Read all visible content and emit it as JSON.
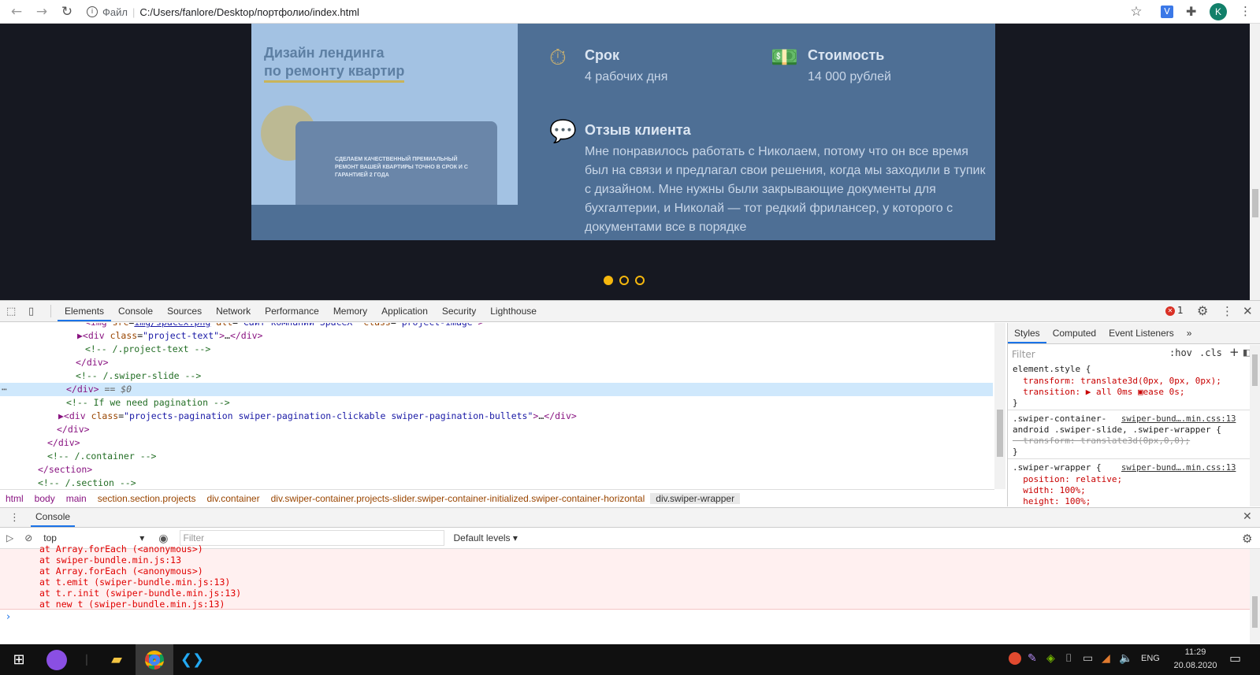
{
  "browser": {
    "protocol_label": "Файл",
    "url": "C:/Users/fanlore/Desktop/портфолио/index.html",
    "profile_initial": "K",
    "ext_label": "V"
  },
  "page": {
    "thumb_title_line1": "Дизайн лендинга",
    "thumb_title_line2": "по ремонту квартир",
    "thumb_screen_text": "СДЕЛАЕМ КАЧЕСТВЕННЫЙ ПРЕМИАЛЬНЫЙ РЕМОНТ ВАШЕЙ КВАРТИРЫ ТОЧНО В СРОК И С ГАРАНТИЕЙ 2 ГОДА",
    "deadline_label": "Срок",
    "deadline_value": "4 рабочих дня",
    "cost_label": "Стоимость",
    "cost_value": "14 000 рублей",
    "review_label": "Отзыв клиента",
    "review_text": "Мне понравилось работать с Николаем, потому что он все время был на связи и предлагал свои решения, когда мы заходили в тупик с дизайном. Мне нужны были закрывающие документы для бухгалтерии, и Николай — тот редкий фрилансер, у которого с документами все в порядке",
    "pagination_active": 1,
    "pagination_count": 3
  },
  "devtools": {
    "tabs": [
      "Elements",
      "Console",
      "Sources",
      "Network",
      "Performance",
      "Memory",
      "Application",
      "Security",
      "Lighthouse"
    ],
    "active_tab": "Elements",
    "error_count": "1",
    "dom_lines": [
      {
        "text": "<img src=\"img/spacex.png\" alt=\"Сайт компании SpaceX\" class=\"project-image\">",
        "indent": 108
      },
      {
        "text": "▶<div class=\"project-text\">…</div>",
        "indent": 98
      },
      {
        "text": "<!-- /.project-text -->",
        "indent": 108
      },
      {
        "text": "</div>",
        "indent": 96
      },
      {
        "text": "<!-- /.swiper-slide -->",
        "indent": 96
      },
      {
        "text": "</div> == $0",
        "indent": 84
      },
      {
        "text": "<!-- If we need pagination -->",
        "indent": 84
      },
      {
        "text": "▶<div class=\"projects-pagination swiper-pagination-clickable swiper-pagination-bullets\">…</div>",
        "indent": 74
      },
      {
        "text": "</div>",
        "indent": 72
      },
      {
        "text": "</div>",
        "indent": 60
      },
      {
        "text": "<!-- /.container -->",
        "indent": 60
      },
      {
        "text": "</section>",
        "indent": 48
      },
      {
        "text": "<!-- /.section -->",
        "indent": 48
      }
    ],
    "breadcrumbs": [
      "html",
      "body",
      "main",
      "section.section.projects",
      "div.container",
      "div.swiper-container.projects-slider.swiper-container-initialized.swiper-container-horizontal",
      "div.swiper-wrapper"
    ],
    "styles_tabs": [
      "Styles",
      "Computed",
      "Event Listeners"
    ],
    "styles_filter_placeholder": "Filter",
    "hov": ":hov",
    "cls": ".cls",
    "style_lines": [
      "element.style {",
      "  transform: translate3d(0px, 0px, 0px);",
      "  transition: ▶ all 0ms ▣ease 0s;",
      "}",
      ".swiper-container-",
      "android .swiper-slide, .swiper-wrapper {",
      "  transform: translate3d(0px,0,0);",
      "}",
      ".swiper-wrapper {",
      "  position: relative;",
      "  width: 100%;",
      "  height: 100%;"
    ],
    "style_source1": "swiper-bund….min.css:13",
    "style_source2": "swiper-bund….min.css:13",
    "console_tab": "Console",
    "context": "top",
    "console_filter_placeholder": "Filter",
    "levels": "Default levels ▾",
    "error_lines": [
      "at Array.forEach (<anonymous>)",
      "at swiper-bundle.min.js:13",
      "at Array.forEach (<anonymous>)",
      "at t.emit (swiper-bundle.min.js:13)",
      "at t.r.init (swiper-bundle.min.js:13)",
      "at new t (swiper-bundle.min.js:13)"
    ],
    "prompt": "›"
  },
  "taskbar": {
    "lang": "ENG",
    "time": "11:29",
    "date": "20.08.2020"
  }
}
